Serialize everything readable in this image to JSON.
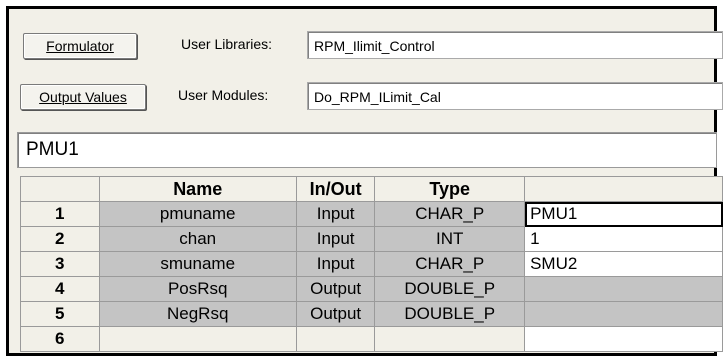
{
  "toolbar": {
    "formulator_label": "Formulator",
    "output_values_label": "Output Values",
    "user_libraries_label": "User Libraries:",
    "user_libraries_value": "RPM_Ilimit_Control",
    "user_modules_label": "User Modules:",
    "user_modules_value": "Do_RPM_ILimit_Cal"
  },
  "name_field": {
    "value": "PMU1"
  },
  "grid": {
    "headers": [
      "",
      "Name",
      "In/Out",
      "Type",
      ""
    ],
    "rows": [
      {
        "num": "1",
        "name": "pmuname",
        "inout": "Input",
        "type": "CHAR_P",
        "value": "PMU1"
      },
      {
        "num": "2",
        "name": "chan",
        "inout": "Input",
        "type": "INT",
        "value": "1"
      },
      {
        "num": "3",
        "name": "smuname",
        "inout": "Input",
        "type": "CHAR_P",
        "value": "SMU2"
      },
      {
        "num": "4",
        "name": "PosRsq",
        "inout": "Output",
        "type": "DOUBLE_P",
        "value": ""
      },
      {
        "num": "5",
        "name": "NegRsq",
        "inout": "Output",
        "type": "DOUBLE_P",
        "value": ""
      },
      {
        "num": "6",
        "name": "",
        "inout": "",
        "type": "",
        "value": ""
      }
    ]
  }
}
